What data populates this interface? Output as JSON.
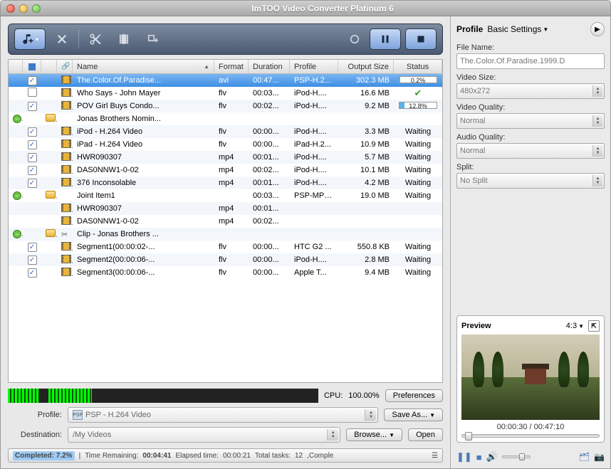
{
  "title": "ImTOO Video Converter Platinum 6",
  "columns": {
    "name": "Name",
    "format": "Format",
    "duration": "Duration",
    "profile": "Profile",
    "output_size": "Output Size",
    "status": "Status"
  },
  "rows": [
    {
      "exp": "",
      "chk": true,
      "ico": "film",
      "name": "The.Color.Of.Paradise...",
      "fmt": "avi",
      "dur": "00:47...",
      "prof": "PSP-H.2...",
      "size": "302.3 MB",
      "status_type": "progress",
      "status_val": "0.2%",
      "status_pct": 0.2,
      "sel": true,
      "indent": 0
    },
    {
      "exp": "",
      "chk": false,
      "ico": "film",
      "name": "Who Says - John Mayer",
      "fmt": "flv",
      "dur": "00:03...",
      "prof": "iPod-H....",
      "size": "16.6 MB",
      "status_type": "done",
      "status_val": "",
      "indent": 0
    },
    {
      "exp": "",
      "chk": true,
      "ico": "film",
      "name": "POV  Girl Buys Condo...",
      "fmt": "flv",
      "dur": "00:02...",
      "prof": "iPod-H....",
      "size": "9.2 MB",
      "status_type": "progress",
      "status_val": "12.8%",
      "status_pct": 12.8,
      "indent": 0
    },
    {
      "exp": "open",
      "ico": "folder",
      "name": "Jonas Brothers Nomin...",
      "fmt": "",
      "dur": "",
      "prof": "",
      "size": "",
      "status_type": "",
      "status_val": "",
      "indent": 0,
      "group": true
    },
    {
      "exp": "",
      "chk": true,
      "ico": "film",
      "name": "iPod - H.264 Video",
      "fmt": "flv",
      "dur": "00:00...",
      "prof": "iPod-H....",
      "size": "3.3 MB",
      "status_type": "text",
      "status_val": "Waiting",
      "indent": 1
    },
    {
      "exp": "",
      "chk": true,
      "ico": "film",
      "name": "iPad - H.264 Video",
      "fmt": "flv",
      "dur": "00:00...",
      "prof": "iPad-H.2...",
      "size": "10.9 MB",
      "status_type": "text",
      "status_val": "Waiting",
      "indent": 1
    },
    {
      "exp": "",
      "chk": true,
      "ico": "film",
      "name": "HWR090307",
      "fmt": "mp4",
      "dur": "00:01...",
      "prof": "iPod-H....",
      "size": "5.7 MB",
      "status_type": "text",
      "status_val": "Waiting",
      "indent": 0
    },
    {
      "exp": "",
      "chk": true,
      "ico": "film",
      "name": "DAS0NNW1-0-02",
      "fmt": "mp4",
      "dur": "00:02...",
      "prof": "iPod-H....",
      "size": "10.1 MB",
      "status_type": "text",
      "status_val": "Waiting",
      "indent": 0
    },
    {
      "exp": "",
      "chk": true,
      "ico": "film",
      "name": "376 Inconsolable",
      "fmt": "mp4",
      "dur": "00:01...",
      "prof": "iPod-H....",
      "size": "4.2 MB",
      "status_type": "text",
      "status_val": "Waiting",
      "indent": 0
    },
    {
      "exp": "open",
      "ico": "folder",
      "name": "Joint Item1",
      "fmt": "",
      "dur": "00:03...",
      "prof": "PSP-MPE...",
      "size": "19.0 MB",
      "status_type": "text",
      "status_val": "Waiting",
      "indent": 0,
      "group": true
    },
    {
      "exp": "",
      "ico": "film",
      "name": "HWR090307",
      "fmt": "mp4",
      "dur": "00:01...",
      "prof": "",
      "size": "",
      "status_type": "",
      "status_val": "",
      "indent": 1,
      "nochk": true
    },
    {
      "exp": "",
      "ico": "film",
      "name": "DAS0NNW1-0-02",
      "fmt": "mp4",
      "dur": "00:02...",
      "prof": "",
      "size": "",
      "status_type": "",
      "status_val": "",
      "indent": 1,
      "nochk": true
    },
    {
      "exp": "open",
      "ico": "folder",
      "ico2": "scissors",
      "name": "Clip - Jonas Brothers ...",
      "fmt": "",
      "dur": "",
      "prof": "",
      "size": "",
      "status_type": "",
      "status_val": "",
      "indent": 0,
      "group": true
    },
    {
      "exp": "",
      "chk": true,
      "ico": "film",
      "name": "Segment1(00:00:02-...",
      "fmt": "flv",
      "dur": "00:00...",
      "prof": "HTC G2 ...",
      "size": "550.8 KB",
      "status_type": "text",
      "status_val": "Waiting",
      "indent": 1
    },
    {
      "exp": "",
      "chk": true,
      "ico": "film",
      "name": "Segment2(00:00:06-...",
      "fmt": "flv",
      "dur": "00:00...",
      "prof": "iPod-H....",
      "size": "2.8 MB",
      "status_type": "text",
      "status_val": "Waiting",
      "indent": 1
    },
    {
      "exp": "",
      "chk": true,
      "ico": "film",
      "name": "Segment3(00:00:06-...",
      "fmt": "flv",
      "dur": "00:00...",
      "prof": "Apple T...",
      "size": "9.4 MB",
      "status_type": "text",
      "status_val": "Waiting",
      "indent": 1
    }
  ],
  "cpu": {
    "label": "CPU:",
    "value": "100.00%",
    "preferences": "Preferences"
  },
  "profile": {
    "label": "Profile:",
    "value": "PSP - H.264 Video",
    "save_as": "Save As..."
  },
  "destination": {
    "label": "Destination:",
    "value": "/My Videos",
    "browse": "Browse...",
    "open": "Open"
  },
  "statusbar": {
    "completed_label": "Completed:",
    "completed_pct": "7.2%",
    "time_remain_label": "Time Remaining:",
    "time_remain": "00:04:41",
    "elapsed_label": "Elapsed time:",
    "elapsed": "00:00:21",
    "total_label": "Total tasks:",
    "total": "12",
    "tail": ",Comple"
  },
  "rpanel": {
    "profile_label": "Profile",
    "tab": "Basic Settings",
    "file_name_label": "File Name:",
    "file_name": "The.Color.Of.Paradise.1999.D",
    "video_size_label": "Video Size:",
    "video_size": "480x272",
    "video_quality_label": "Video Quality:",
    "video_quality": "Normal",
    "audio_quality_label": "Audio Quality:",
    "audio_quality": "Normal",
    "split_label": "Split:",
    "split": "No Split"
  },
  "preview": {
    "title": "Preview",
    "aspect": "4:3",
    "time": "00:00:30 / 00:47:10"
  }
}
